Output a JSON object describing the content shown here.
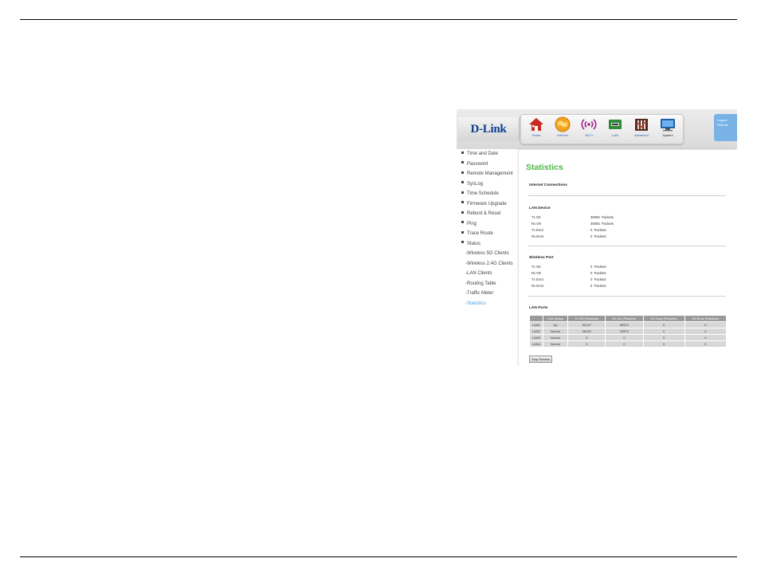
{
  "brand": {
    "logo_text": "D-Link"
  },
  "nav": {
    "items": [
      {
        "label": "Home",
        "icon": "house-icon"
      },
      {
        "label": "Internet",
        "icon": "globe-icon"
      },
      {
        "label": "Wi-Fi",
        "icon": "wifi-icon"
      },
      {
        "label": "LAN",
        "icon": "lan-icon"
      },
      {
        "label": "Advanced",
        "icon": "advanced-icon"
      },
      {
        "label": "System",
        "icon": "monitor-icon"
      }
    ],
    "active": "System"
  },
  "top_right": {
    "logout": "Logout",
    "refresh": "Refresh"
  },
  "sidebar": {
    "items": [
      "Time and Date",
      "Password",
      "Remote Management",
      "SysLog",
      "Time Schedule",
      "Firmware Upgrade",
      "Reboot & Reset",
      "Ping",
      "Trace Route",
      "Status"
    ],
    "subitems": [
      "-Wireless 5G Clients",
      "-Wireless 2.4G Clients",
      "-LAN Clients",
      "-Routing Table",
      "-Traffic Meter",
      "-Statistics"
    ],
    "active": "-Statistics"
  },
  "content": {
    "title": "Statistics",
    "internet_section": "Internet Connections",
    "lan_device": {
      "title": "LAN Device",
      "rows": [
        {
          "label": "Tx OK",
          "value": "35059",
          "unit": "Packets"
        },
        {
          "label": "Rx OK",
          "value": "30065",
          "unit": "Packets"
        },
        {
          "label": "Tx Error",
          "value": "0",
          "unit": "Packets"
        },
        {
          "label": "Rx Error",
          "value": "0",
          "unit": "Packets"
        }
      ]
    },
    "wireless_port": {
      "title": "Wireless Port",
      "rows": [
        {
          "label": "Tx OK",
          "value": "0",
          "unit": "Packets"
        },
        {
          "label": "Rx OK",
          "value": "0",
          "unit": "Packets"
        },
        {
          "label": "Tx Error",
          "value": "0",
          "unit": "Packets"
        },
        {
          "label": "Rx Error",
          "value": "0",
          "unit": "Packets"
        }
      ]
    },
    "lan_ports": {
      "title": "LAN Ports",
      "headers": [
        "",
        "Link Status",
        "Tx OK (Packets)",
        "Rx OK (Packets)",
        "Rx Drop (Packets)",
        "Rx Error (Packets)"
      ],
      "rows": [
        [
          "LAN1",
          "Up",
          "92147",
          "80573",
          "0",
          "0"
        ],
        [
          "LAN2",
          "NoLink",
          "46020",
          "20879",
          "0",
          "0"
        ],
        [
          "LAN3",
          "NoLink",
          "0",
          "0",
          "0",
          "0"
        ],
        [
          "LAN4",
          "NoLink",
          "0",
          "0",
          "0",
          "0"
        ]
      ]
    },
    "stop_refresh": "Stop Refresh"
  },
  "colors": {
    "title_green": "#4cb848",
    "active_link": "#4aa0e6",
    "logo_blue": "#0e3f8e",
    "panel_blue": "#79b3e6",
    "table_header": "#9a9a9a",
    "table_cell": "#d7d7d7"
  }
}
